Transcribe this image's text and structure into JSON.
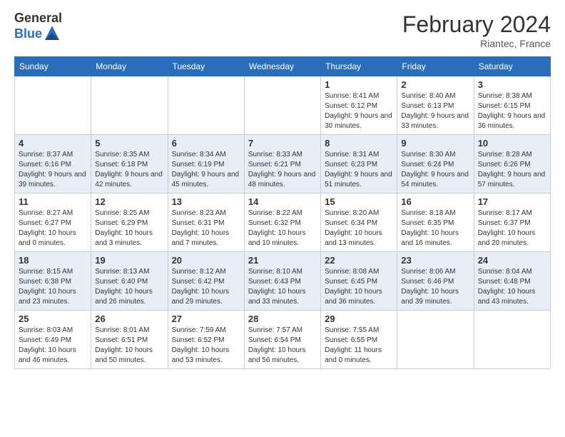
{
  "header": {
    "logo_general": "General",
    "logo_blue": "Blue",
    "month_title": "February 2024",
    "location": "Riantec, France"
  },
  "days_of_week": [
    "Sunday",
    "Monday",
    "Tuesday",
    "Wednesday",
    "Thursday",
    "Friday",
    "Saturday"
  ],
  "weeks": [
    {
      "days": [
        {
          "num": "",
          "info": ""
        },
        {
          "num": "",
          "info": ""
        },
        {
          "num": "",
          "info": ""
        },
        {
          "num": "",
          "info": ""
        },
        {
          "num": "1",
          "info": "Sunrise: 8:41 AM\nSunset: 6:12 PM\nDaylight: 9 hours\nand 30 minutes."
        },
        {
          "num": "2",
          "info": "Sunrise: 8:40 AM\nSunset: 6:13 PM\nDaylight: 9 hours\nand 33 minutes."
        },
        {
          "num": "3",
          "info": "Sunrise: 8:38 AM\nSunset: 6:15 PM\nDaylight: 9 hours\nand 36 minutes."
        }
      ]
    },
    {
      "days": [
        {
          "num": "4",
          "info": "Sunrise: 8:37 AM\nSunset: 6:16 PM\nDaylight: 9 hours\nand 39 minutes."
        },
        {
          "num": "5",
          "info": "Sunrise: 8:35 AM\nSunset: 6:18 PM\nDaylight: 9 hours\nand 42 minutes."
        },
        {
          "num": "6",
          "info": "Sunrise: 8:34 AM\nSunset: 6:19 PM\nDaylight: 9 hours\nand 45 minutes."
        },
        {
          "num": "7",
          "info": "Sunrise: 8:33 AM\nSunset: 6:21 PM\nDaylight: 9 hours\nand 48 minutes."
        },
        {
          "num": "8",
          "info": "Sunrise: 8:31 AM\nSunset: 6:23 PM\nDaylight: 9 hours\nand 51 minutes."
        },
        {
          "num": "9",
          "info": "Sunrise: 8:30 AM\nSunset: 6:24 PM\nDaylight: 9 hours\nand 54 minutes."
        },
        {
          "num": "10",
          "info": "Sunrise: 8:28 AM\nSunset: 6:26 PM\nDaylight: 9 hours\nand 57 minutes."
        }
      ]
    },
    {
      "days": [
        {
          "num": "11",
          "info": "Sunrise: 8:27 AM\nSunset: 6:27 PM\nDaylight: 10 hours\nand 0 minutes."
        },
        {
          "num": "12",
          "info": "Sunrise: 8:25 AM\nSunset: 6:29 PM\nDaylight: 10 hours\nand 3 minutes."
        },
        {
          "num": "13",
          "info": "Sunrise: 8:23 AM\nSunset: 6:31 PM\nDaylight: 10 hours\nand 7 minutes."
        },
        {
          "num": "14",
          "info": "Sunrise: 8:22 AM\nSunset: 6:32 PM\nDaylight: 10 hours\nand 10 minutes."
        },
        {
          "num": "15",
          "info": "Sunrise: 8:20 AM\nSunset: 6:34 PM\nDaylight: 10 hours\nand 13 minutes."
        },
        {
          "num": "16",
          "info": "Sunrise: 8:18 AM\nSunset: 6:35 PM\nDaylight: 10 hours\nand 16 minutes."
        },
        {
          "num": "17",
          "info": "Sunrise: 8:17 AM\nSunset: 6:37 PM\nDaylight: 10 hours\nand 20 minutes."
        }
      ]
    },
    {
      "days": [
        {
          "num": "18",
          "info": "Sunrise: 8:15 AM\nSunset: 6:38 PM\nDaylight: 10 hours\nand 23 minutes."
        },
        {
          "num": "19",
          "info": "Sunrise: 8:13 AM\nSunset: 6:40 PM\nDaylight: 10 hours\nand 26 minutes."
        },
        {
          "num": "20",
          "info": "Sunrise: 8:12 AM\nSunset: 6:42 PM\nDaylight: 10 hours\nand 29 minutes."
        },
        {
          "num": "21",
          "info": "Sunrise: 8:10 AM\nSunset: 6:43 PM\nDaylight: 10 hours\nand 33 minutes."
        },
        {
          "num": "22",
          "info": "Sunrise: 8:08 AM\nSunset: 6:45 PM\nDaylight: 10 hours\nand 36 minutes."
        },
        {
          "num": "23",
          "info": "Sunrise: 8:06 AM\nSunset: 6:46 PM\nDaylight: 10 hours\nand 39 minutes."
        },
        {
          "num": "24",
          "info": "Sunrise: 8:04 AM\nSunset: 6:48 PM\nDaylight: 10 hours\nand 43 minutes."
        }
      ]
    },
    {
      "days": [
        {
          "num": "25",
          "info": "Sunrise: 8:03 AM\nSunset: 6:49 PM\nDaylight: 10 hours\nand 46 minutes."
        },
        {
          "num": "26",
          "info": "Sunrise: 8:01 AM\nSunset: 6:51 PM\nDaylight: 10 hours\nand 50 minutes."
        },
        {
          "num": "27",
          "info": "Sunrise: 7:59 AM\nSunset: 6:52 PM\nDaylight: 10 hours\nand 53 minutes."
        },
        {
          "num": "28",
          "info": "Sunrise: 7:57 AM\nSunset: 6:54 PM\nDaylight: 10 hours\nand 56 minutes."
        },
        {
          "num": "29",
          "info": "Sunrise: 7:55 AM\nSunset: 6:55 PM\nDaylight: 11 hours\nand 0 minutes."
        },
        {
          "num": "",
          "info": ""
        },
        {
          "num": "",
          "info": ""
        }
      ]
    }
  ]
}
